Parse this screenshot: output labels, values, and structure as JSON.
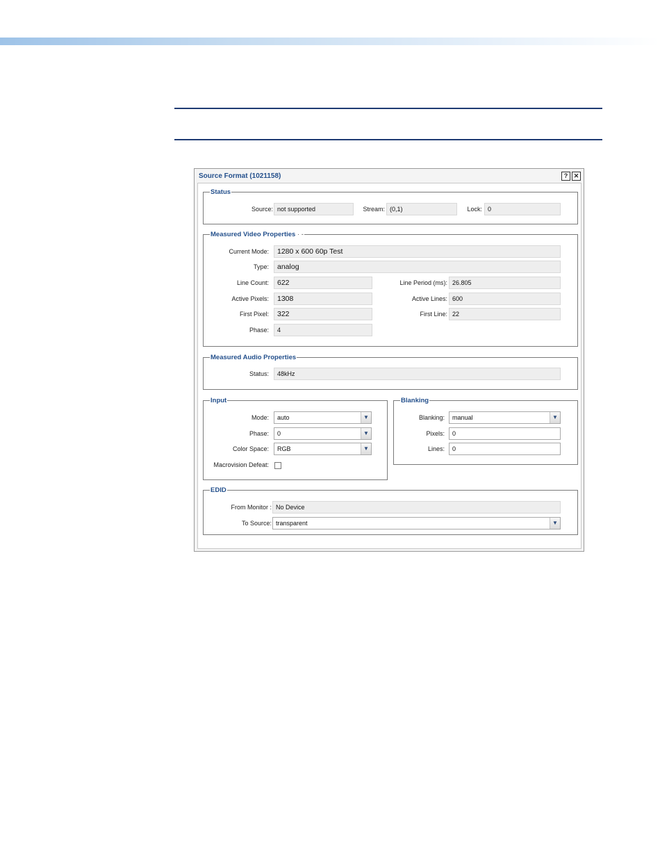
{
  "window": {
    "title": "Source Format (1021158)",
    "help_glyph": "?",
    "close_glyph": "✕"
  },
  "status": {
    "legend": "Status",
    "source_label": "Source:",
    "source_value": "not supported",
    "stream_label": "Stream:",
    "stream_value": "(0,1)",
    "lock_label": "Lock:",
    "lock_value": "0"
  },
  "video": {
    "legend": "Measured Video Properties",
    "current_mode_label": "Current Mode:",
    "current_mode_value": "1280 x 600 60p Test",
    "type_label": "Type:",
    "type_value": "analog",
    "line_count_label": "Line Count:",
    "line_count_value": "622",
    "line_period_label": "Line Period (ms):",
    "line_period_value": "26.805",
    "active_pixels_label": "Active Pixels:",
    "active_pixels_value": "1308",
    "active_lines_label": "Active Lines:",
    "active_lines_value": "600",
    "first_pixel_label": "First Pixel:",
    "first_pixel_value": "322",
    "first_line_label": "First Line:",
    "first_line_value": "22",
    "phase_label": "Phase:",
    "phase_value": "4"
  },
  "audio": {
    "legend": "Measured Audio Properties",
    "status_label": "Status:",
    "status_value": "48kHz"
  },
  "input": {
    "legend": "Input",
    "mode_label": "Mode:",
    "mode_value": "auto",
    "phase_label": "Phase:",
    "phase_value": "0",
    "color_space_label": "Color Space:",
    "color_space_value": "RGB",
    "macrovision_label": "Macrovision Defeat:",
    "macrovision_checked": false
  },
  "blanking": {
    "legend": "Blanking",
    "blanking_label": "Blanking:",
    "blanking_value": "manual",
    "pixels_label": "Pixels:",
    "pixels_value": "0",
    "lines_label": "Lines:",
    "lines_value": "0"
  },
  "edid": {
    "legend": "EDID",
    "from_monitor_label": "From Monitor :",
    "from_monitor_value": "No Device",
    "to_source_label": "To Source:",
    "to_source_value": "transparent"
  },
  "colors": {
    "accent": "#24508c",
    "note_rule": "#1f3b73"
  },
  "icons": {
    "dropdown": "chevron-down-icon",
    "help": "help-icon",
    "close": "close-icon"
  }
}
